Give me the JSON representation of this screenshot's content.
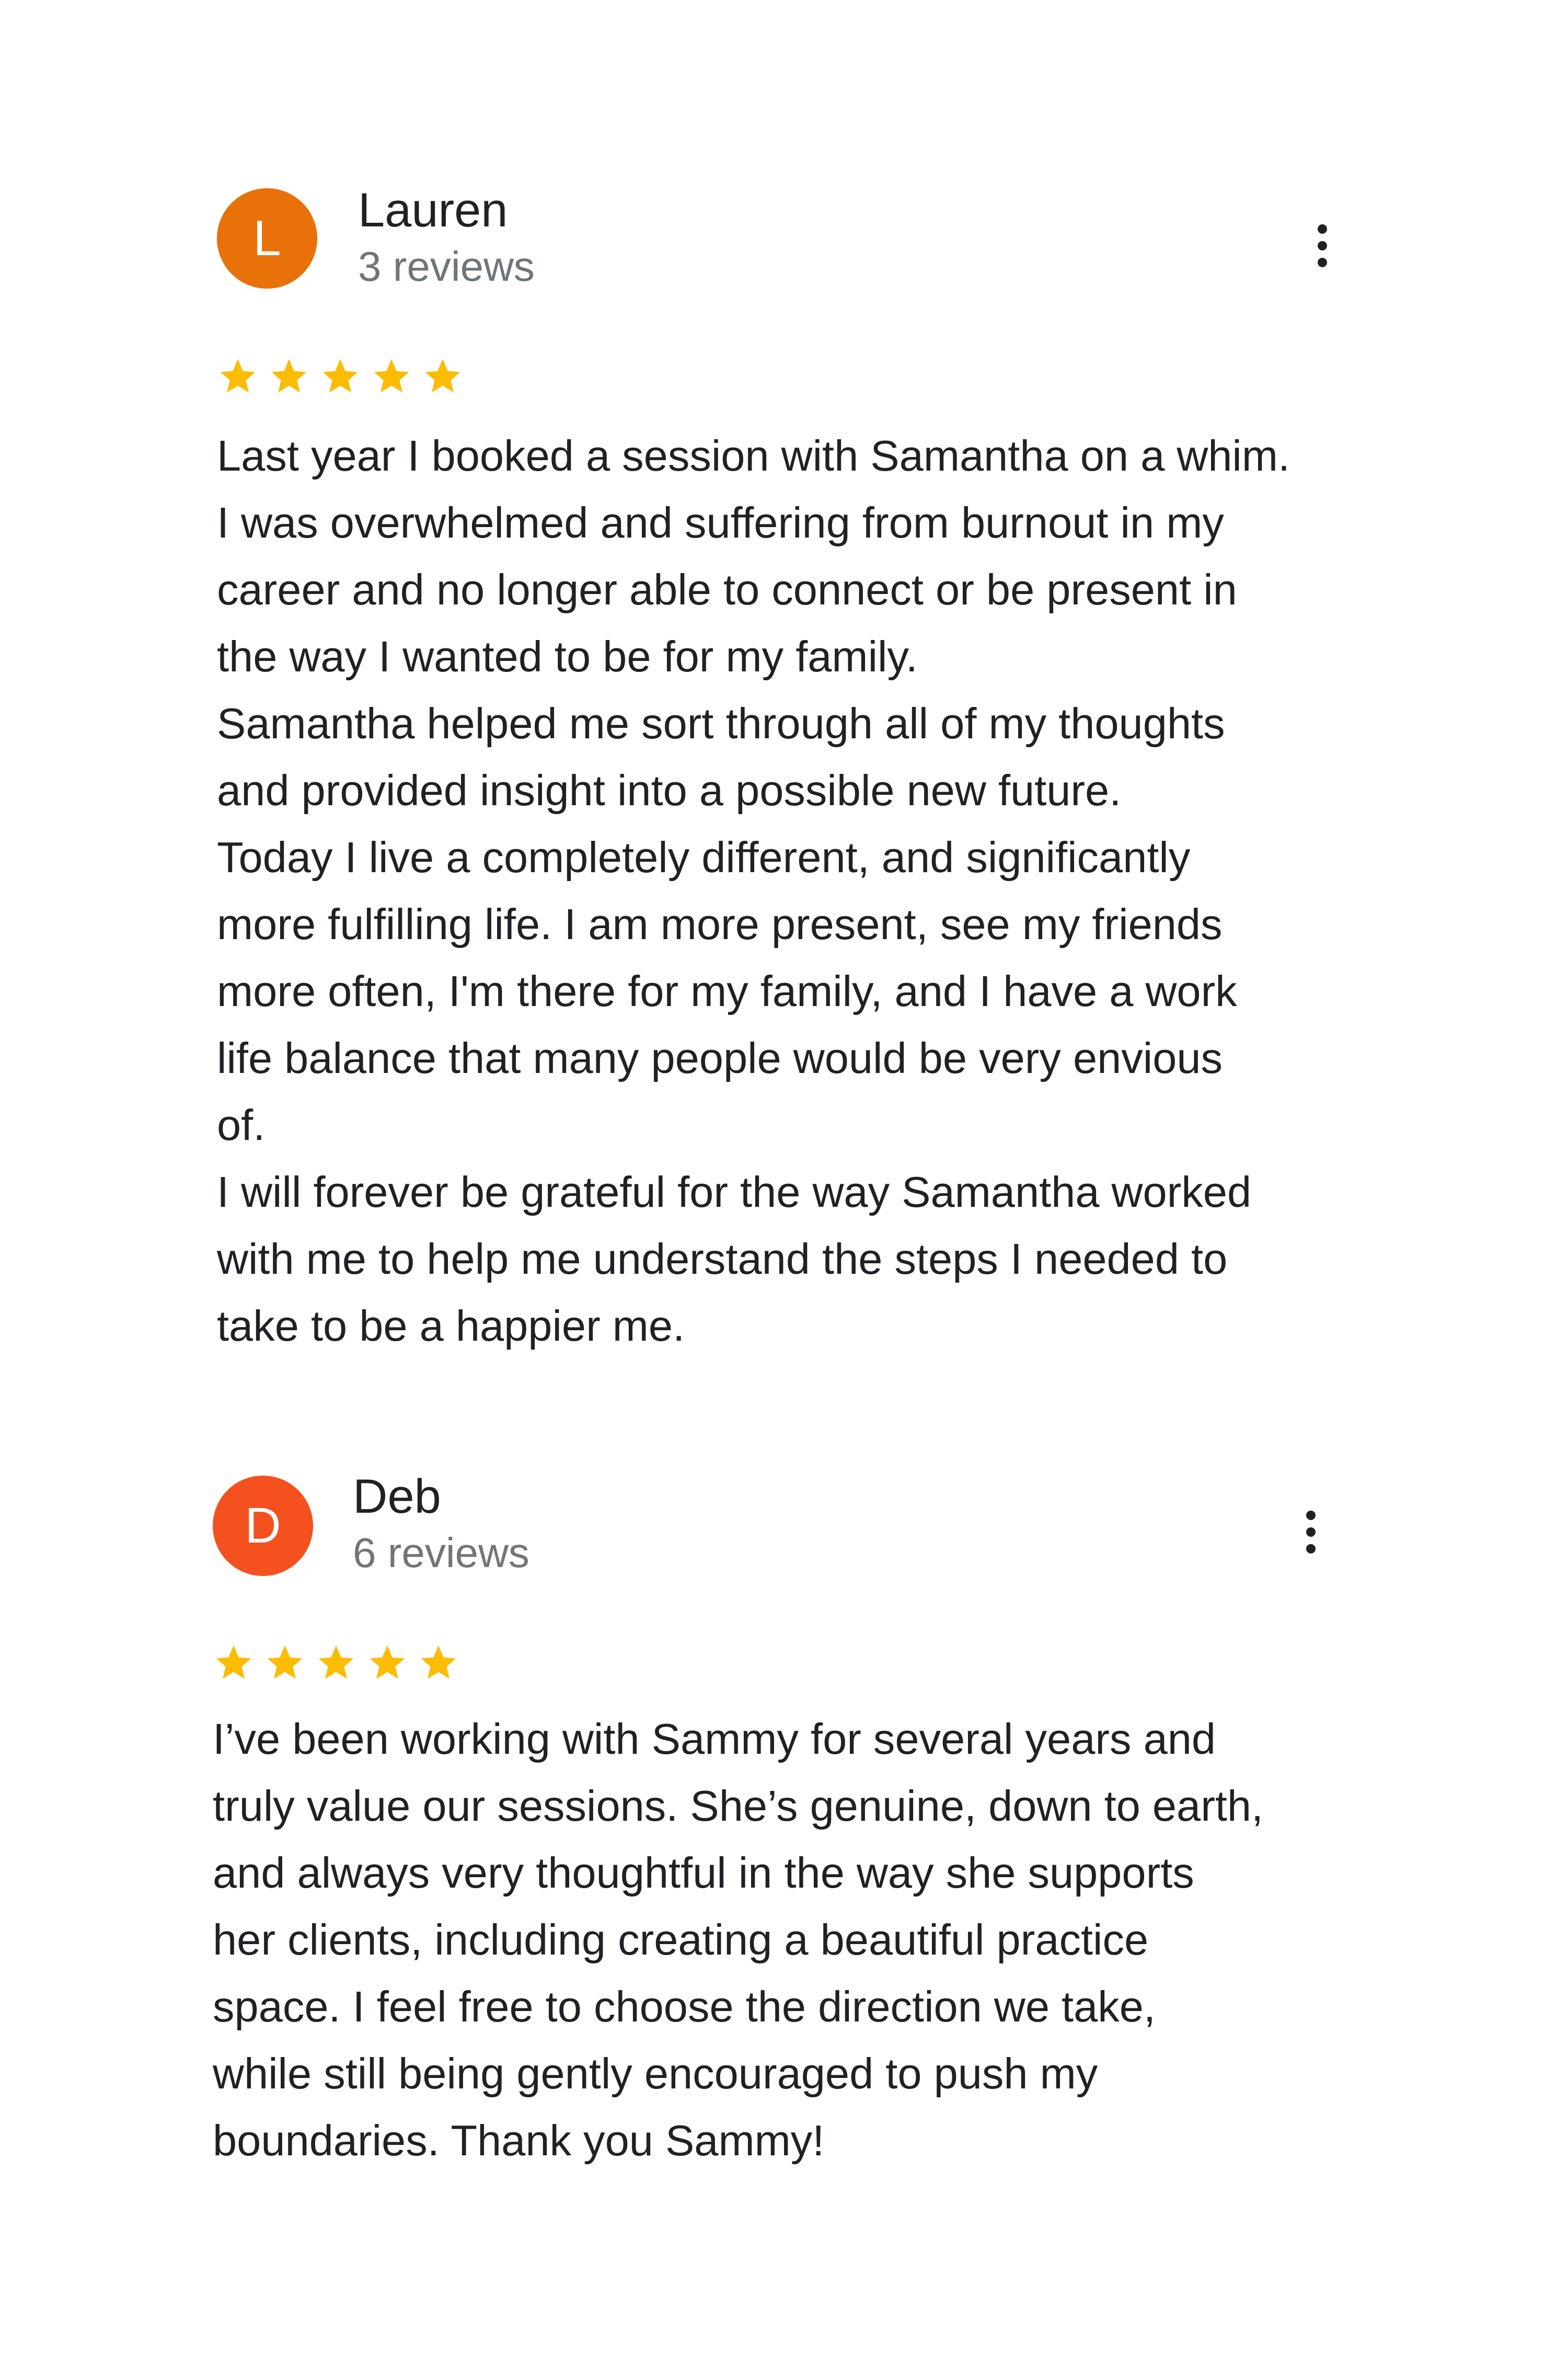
{
  "reviews": [
    {
      "avatar_letter": "L",
      "avatar_color": "#e8710a",
      "name": "Lauren",
      "review_count": "3 reviews",
      "rating": 5,
      "star_color": "#fbbc04",
      "text": "Last year I booked a session with Samantha on a whim.\nI was overwhelmed and suffering from burnout in my\ncareer and no longer able to connect or be present in\nthe way I wanted to be for my family.\nSamantha helped me sort through all of my thoughts\nand provided insight into a possible new future.\nToday I live a completely different, and significantly\nmore fulfilling life. I am more present, see my friends\nmore often, I'm there for my family, and I have a work\nlife balance that many people would be very envious\nof.\nI will forever be grateful for the way Samantha worked\nwith me to help me understand the steps I needed to\ntake to be a happier me."
    },
    {
      "avatar_letter": "D",
      "avatar_color": "#f4511e",
      "name": "Deb",
      "review_count": "6 reviews",
      "rating": 5,
      "star_color": "#fbbc04",
      "text": "I’ve been working with Sammy for several years and\ntruly value our sessions. She’s genuine, down to earth,\nand always very thoughtful in the way she supports\nher clients, including creating a beautiful practice\nspace. I feel free to choose the direction we take,\nwhile still being gently encouraged to push my\nboundaries. Thank you Sammy!"
    }
  ]
}
